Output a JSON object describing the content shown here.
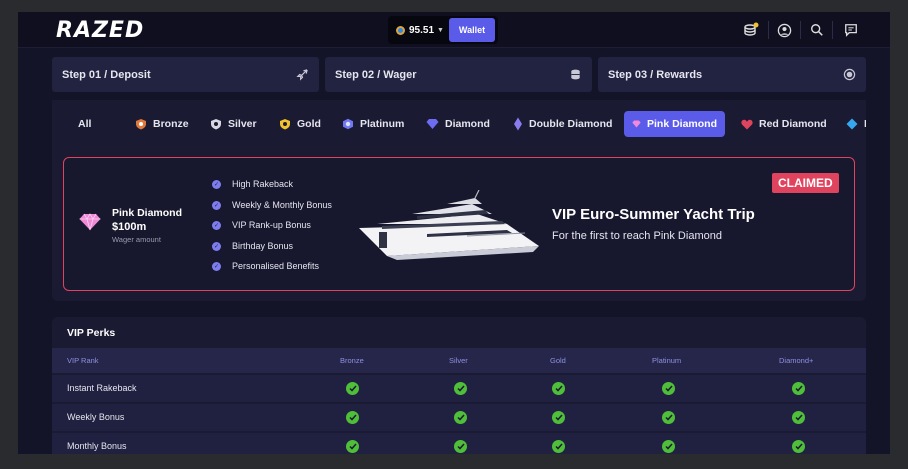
{
  "header": {
    "logo": "RAZED",
    "balance": "95.51",
    "wallet_label": "Wallet"
  },
  "steps": [
    {
      "label": "Step 01 / Deposit",
      "icon": "rocket-icon"
    },
    {
      "label": "Step 02 / Wager",
      "icon": "coins-stack-icon"
    },
    {
      "label": "Step 03 / Rewards",
      "icon": "badge-icon"
    }
  ],
  "tiers": [
    {
      "label": "All",
      "icon": "",
      "color": ""
    },
    {
      "label": "Bronze",
      "icon": "shield-icon",
      "color": "#e07a3a"
    },
    {
      "label": "Silver",
      "icon": "shield-icon",
      "color": "#d8d8e0"
    },
    {
      "label": "Gold",
      "icon": "shield-icon",
      "color": "#f2c12e"
    },
    {
      "label": "Platinum",
      "icon": "hex-shield-icon",
      "color": "#6f78f0"
    },
    {
      "label": "Diamond",
      "icon": "diamond-icon",
      "color": "#6d6df2"
    },
    {
      "label": "Double Diamond",
      "icon": "double-diamond-icon",
      "color": "#8a7cf0"
    },
    {
      "label": "Pink Diamond",
      "icon": "diamond-icon",
      "color": "#f08ad8",
      "active": true
    },
    {
      "label": "Red Diamond",
      "icon": "heart-icon",
      "color": "#e0435e"
    },
    {
      "label": "Bl",
      "icon": "diamond-icon",
      "color": "#37a8f0"
    }
  ],
  "reward": {
    "tier_name": "Pink Diamond",
    "amount": "$100m",
    "amount_sub": "Wager amount",
    "benefits": [
      "High Rakeback",
      "Weekly & Monthly Bonus",
      "VIP Rank-up Bonus",
      "Birthday Bonus",
      "Personalised Benefits"
    ],
    "title": "VIP Euro-Summer Yacht Trip",
    "subtitle": "For the first to reach Pink Diamond",
    "status": "CLAIMED"
  },
  "perks": {
    "title": "VIP Perks",
    "columns": [
      "VIP Rank",
      "Bronze",
      "Silver",
      "Gold",
      "Platinum",
      "Diamond+"
    ],
    "rows": [
      {
        "label": "Instant Rakeback",
        "checks": [
          true,
          true,
          true,
          true,
          true
        ]
      },
      {
        "label": "Weekly Bonus",
        "checks": [
          true,
          true,
          true,
          true,
          true
        ]
      },
      {
        "label": "Monthly Bonus",
        "checks": [
          true,
          true,
          true,
          true,
          true
        ]
      }
    ]
  },
  "colors": {
    "accent": "#5b5bea",
    "claimed": "#e0435e",
    "check": "#4fbf39",
    "background": "#141429"
  }
}
